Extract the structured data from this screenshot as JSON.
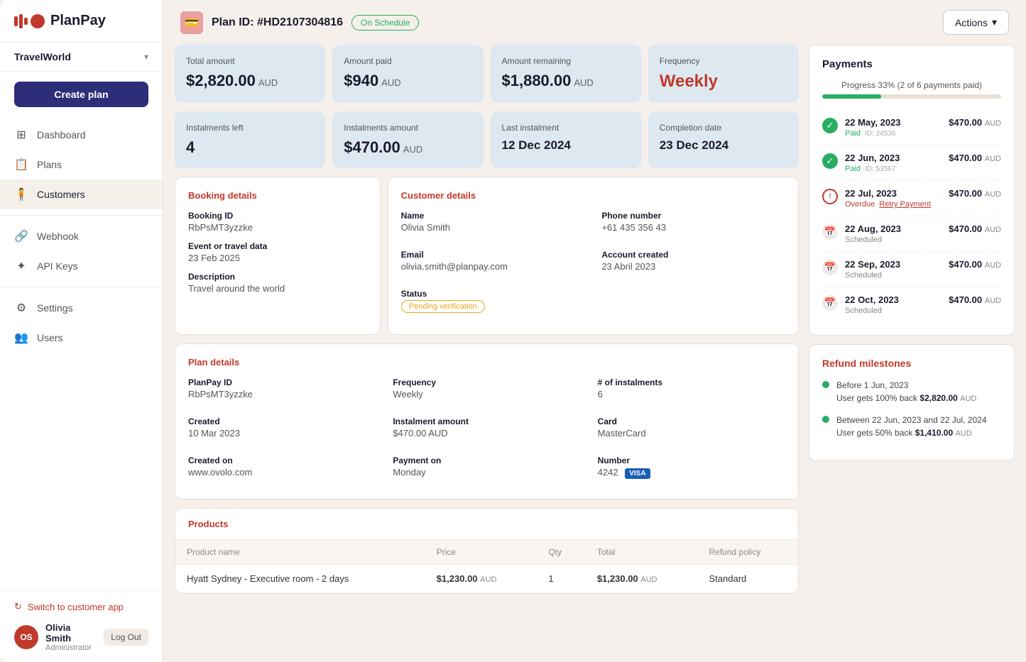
{
  "app": {
    "logo_text": "PlanPay"
  },
  "sidebar": {
    "org_name": "TravelWorld",
    "create_plan_label": "Create plan",
    "nav_items": [
      {
        "id": "dashboard",
        "label": "Dashboard",
        "icon": "⊞"
      },
      {
        "id": "plans",
        "label": "Plans",
        "icon": "📋"
      },
      {
        "id": "customers",
        "label": "Customers",
        "icon": "🧍"
      },
      {
        "id": "webhook",
        "label": "Webhook",
        "icon": "🔗"
      },
      {
        "id": "api-keys",
        "label": "API Keys",
        "icon": "✦"
      },
      {
        "id": "settings",
        "label": "Settings",
        "icon": "⚙"
      },
      {
        "id": "users",
        "label": "Users",
        "icon": "👥"
      }
    ],
    "switch_customer_label": "Switch to customer app",
    "user": {
      "initials": "OS",
      "name": "Olivia Smith",
      "role": "Administrator",
      "logout_label": "Log Out"
    }
  },
  "topbar": {
    "plan_id": "Plan ID: #HD2107304816",
    "status_badge": "On Schedule",
    "actions_label": "Actions"
  },
  "stats": [
    {
      "label": "Total amount",
      "value": "$2,820.00",
      "currency": "AUD"
    },
    {
      "label": "Amount paid",
      "value": "$940",
      "currency": "AUD"
    },
    {
      "label": "Amount remaining",
      "value": "$1,880.00",
      "currency": "AUD"
    },
    {
      "label": "Frequency",
      "value": "Weekly",
      "currency": ""
    }
  ],
  "stats2": [
    {
      "label": "Instalments left",
      "value": "4",
      "currency": ""
    },
    {
      "label": "Instalments amount",
      "value": "$470.00",
      "currency": "AUD"
    },
    {
      "label": "Last instalment",
      "value": "12 Dec 2024",
      "currency": ""
    },
    {
      "label": "Completion date",
      "value": "23 Dec 2024",
      "currency": ""
    }
  ],
  "booking": {
    "title": "Booking details",
    "booking_id_label": "Booking ID",
    "booking_id": "RbPsMT3yzzke",
    "event_label": "Event or travel data",
    "event_value": "23 Feb 2025",
    "description_label": "Description",
    "description_value": "Travel around the world"
  },
  "customer": {
    "title": "Customer details",
    "name_label": "Name",
    "name": "Olivia Smith",
    "phone_label": "Phone number",
    "phone": "+61 435 356 43",
    "email_label": "Email",
    "email": "olivia.smith@planpay.com",
    "account_created_label": "Account created",
    "account_created": "23 Abril 2023",
    "status_label": "Status",
    "status": "Pending verification"
  },
  "plan": {
    "title": "Plan details",
    "planpay_id_label": "PlanPay ID",
    "planpay_id": "RbPsMT3yzzke",
    "frequency_label": "Frequency",
    "frequency": "Weekly",
    "instalments_label": "# of instalments",
    "instalments": "6",
    "created_label": "Created",
    "created": "10 Mar 2023",
    "instalment_amount_label": "Instalment amount",
    "instalment_amount": "$470.00 AUD",
    "card_label": "Card",
    "card": "MasterCard",
    "created_on_label": "Created on",
    "created_on": "www.ovolo.com",
    "payment_on_label": "Payment on",
    "payment_on": "Monday",
    "number_label": "Number",
    "number": "4242"
  },
  "products": {
    "title": "Products",
    "columns": [
      "Product name",
      "Price",
      "Qty",
      "Total",
      "Refund policy"
    ],
    "rows": [
      {
        "name": "Hyatt Sydney - Executive room - 2 days",
        "price": "$1,230.00",
        "price_currency": "AUD",
        "qty": "1",
        "total": "$1,230.00",
        "total_currency": "AUD",
        "refund_policy": "Standard"
      }
    ]
  },
  "payments": {
    "title": "Payments",
    "progress_label": "Progress 33% (2 of 6 payments paid)",
    "progress_pct": 33,
    "items": [
      {
        "date": "22 May, 2023",
        "status": "Paid",
        "id": "ID: 24536",
        "amount": "$470.00",
        "currency": "AUD",
        "type": "paid"
      },
      {
        "date": "22 Jun, 2023",
        "status": "Paid",
        "id": "ID: 53567",
        "amount": "$470.00",
        "currency": "AUD",
        "type": "paid"
      },
      {
        "date": "22 Jul, 2023",
        "status": "Overdue",
        "id": "",
        "amount": "$470.00",
        "currency": "AUD",
        "type": "overdue",
        "retry_label": "Retry Payment"
      },
      {
        "date": "22 Aug, 2023",
        "status": "Scheduled",
        "id": "",
        "amount": "$470.00",
        "currency": "AUD",
        "type": "scheduled"
      },
      {
        "date": "22 Sep, 2023",
        "status": "Scheduled",
        "id": "",
        "amount": "$470.00",
        "currency": "AUD",
        "type": "scheduled"
      },
      {
        "date": "22 Oct, 2023",
        "status": "Scheduled",
        "id": "",
        "amount": "$470.00",
        "currency": "AUD",
        "type": "scheduled"
      }
    ]
  },
  "refund": {
    "title": "Refund milestones",
    "items": [
      {
        "label": "Before 1 Jun, 2023",
        "desc": "User gets 100% back",
        "amount": "$2,820.00",
        "currency": "AUD"
      },
      {
        "label": "Between 22 Jun, 2023 and 22 Jul, 2024",
        "desc": "User gets 50% back",
        "amount": "$1,410.00",
        "currency": "AUD"
      }
    ]
  }
}
